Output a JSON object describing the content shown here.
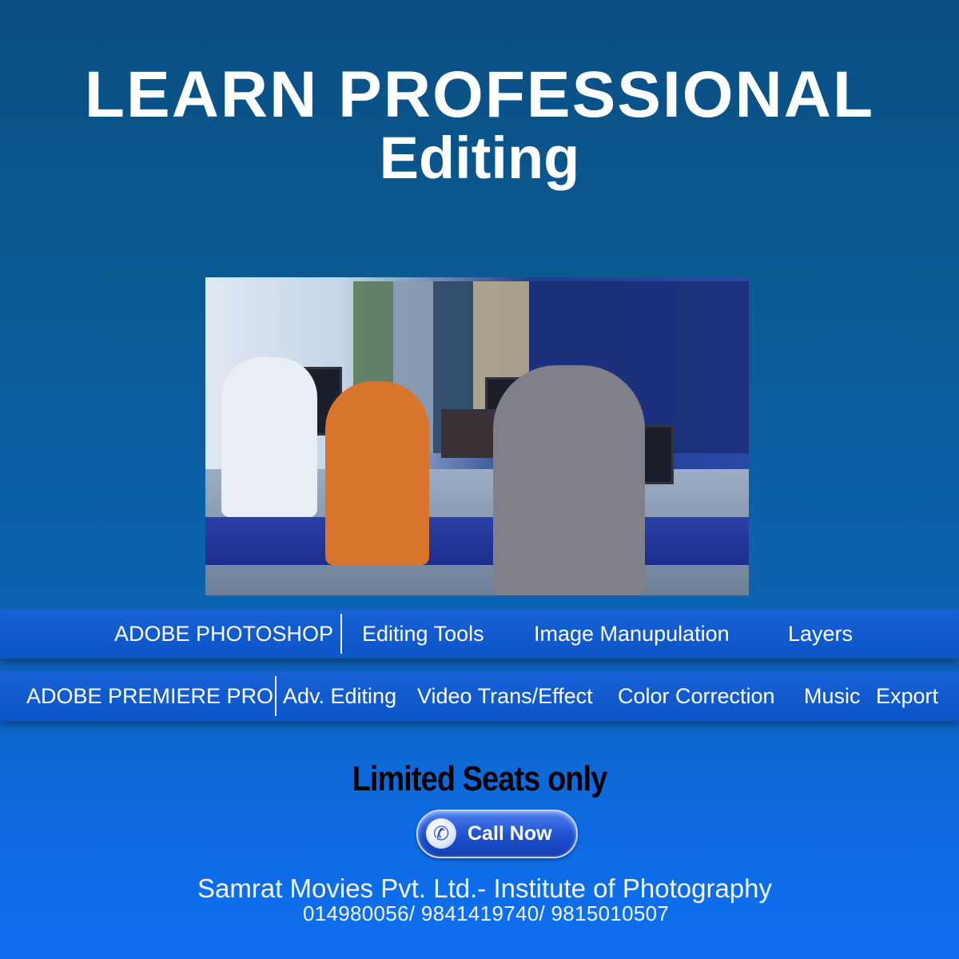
{
  "headline": {
    "line1": "LEARN PROFESSIONAL",
    "line2": "Editing"
  },
  "photoshop_row": {
    "course": "ADOBE PHOTOSHOP",
    "topics": [
      "Editing Tools",
      "Image Manupulation",
      "Layers"
    ]
  },
  "premiere_row": {
    "course": "ADOBE PREMIERE PRO",
    "topics": [
      "Adv. Editing",
      "Video Trans/Effect",
      "Color Correction",
      "Music",
      "Export"
    ]
  },
  "cta": {
    "seats": "Limited Seats only",
    "call_label": "Call Now",
    "icon": "phone-icon"
  },
  "footer": {
    "company": "Samrat Movies Pvt. Ltd.- Institute of Photography",
    "phones": "014980056/ 9841419740/ 9815010507"
  },
  "colors": {
    "band": "#1760d6",
    "background": "#0b5a93",
    "headline": "#ffffff"
  }
}
